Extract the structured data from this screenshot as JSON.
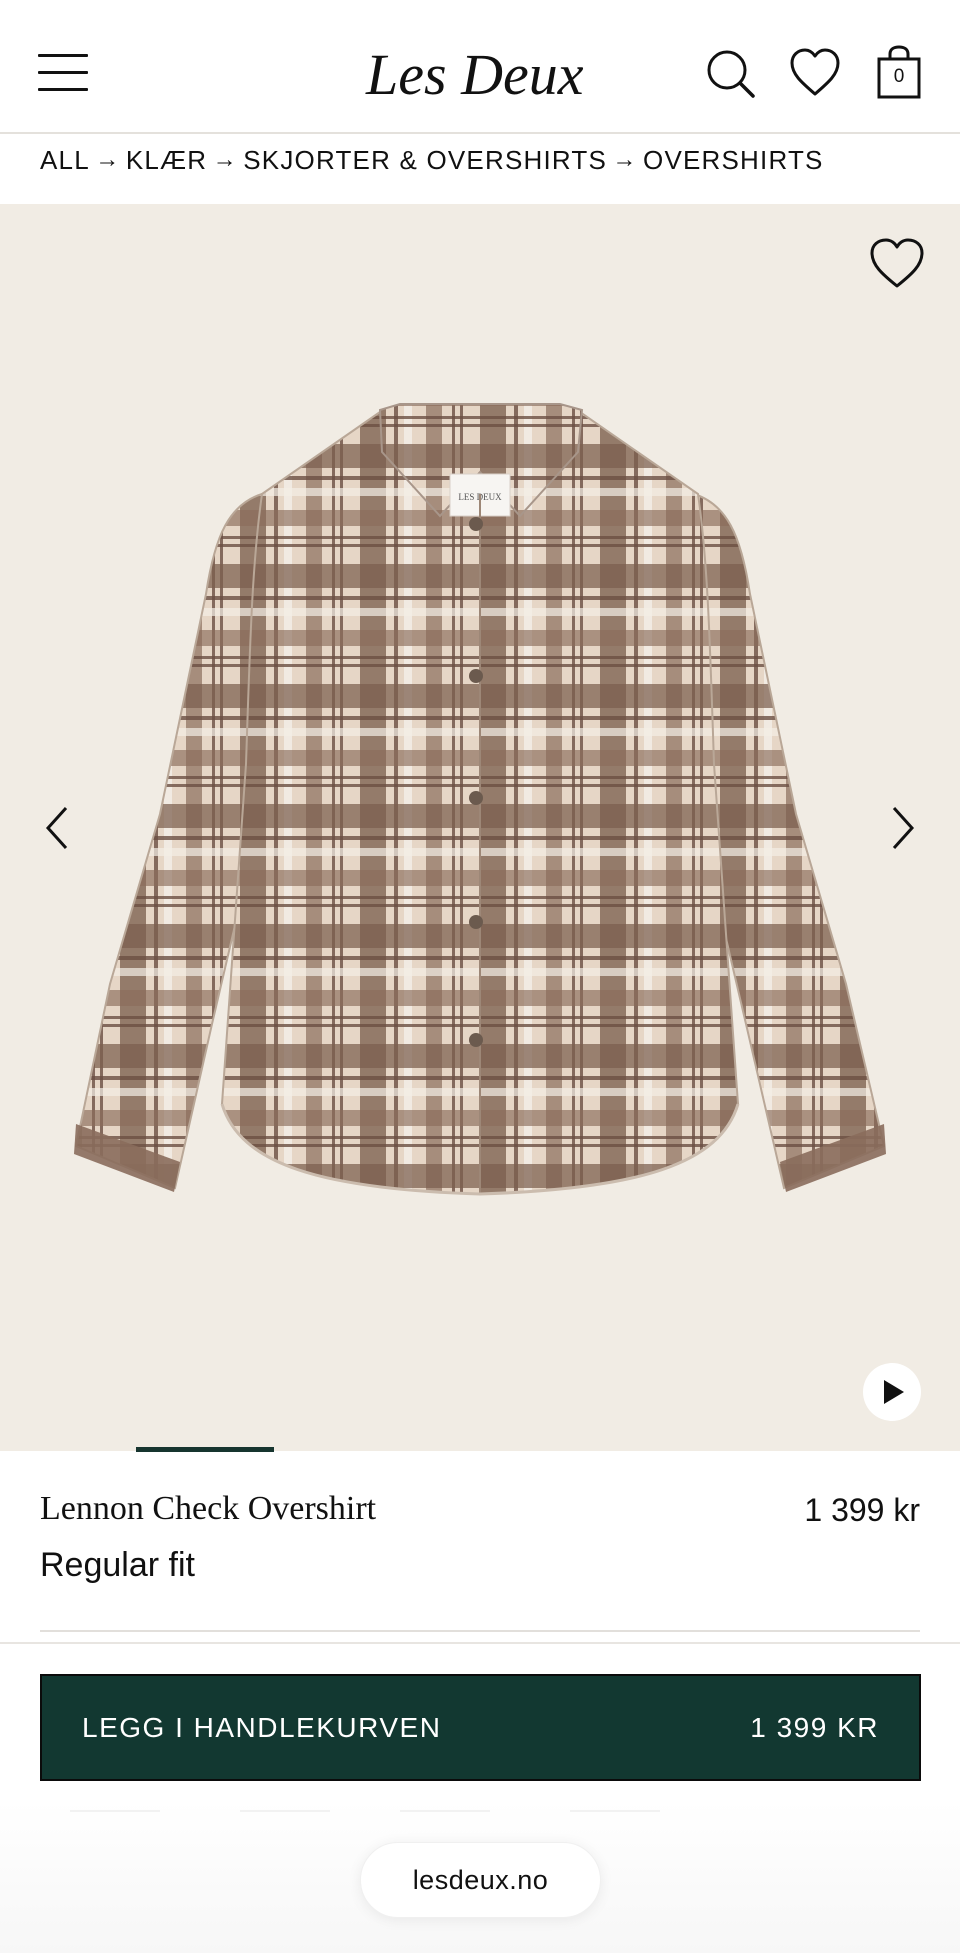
{
  "header": {
    "brand": "Les Deux",
    "cart_count": "0",
    "icons": [
      "menu-icon",
      "search-icon",
      "heart-icon",
      "bag-icon"
    ]
  },
  "breadcrumb": {
    "items": [
      "ALL",
      "KLÆR",
      "SKJORTER & OVERSHIRTS",
      "OVERSHIRTS"
    ],
    "separator": "→"
  },
  "gallery": {
    "image_alt": "brown and beige check overshirt",
    "label_text": "LES DEUX",
    "current_image": 2,
    "icons": [
      "heart-outline-icon",
      "chevron-left-icon",
      "chevron-right-icon",
      "play-icon"
    ]
  },
  "product": {
    "name": "Lennon Check Overshirt",
    "price": "1 399 kr",
    "fit": "Regular fit"
  },
  "cart": {
    "button_label": "LEGG I HANDLEKURVEN",
    "button_price": "1 399 KR"
  },
  "browser": {
    "url": "lesdeux.no"
  },
  "colors": {
    "accent": "#123831",
    "gallery_bg": "#f1ece4",
    "progress": "#17352f"
  }
}
